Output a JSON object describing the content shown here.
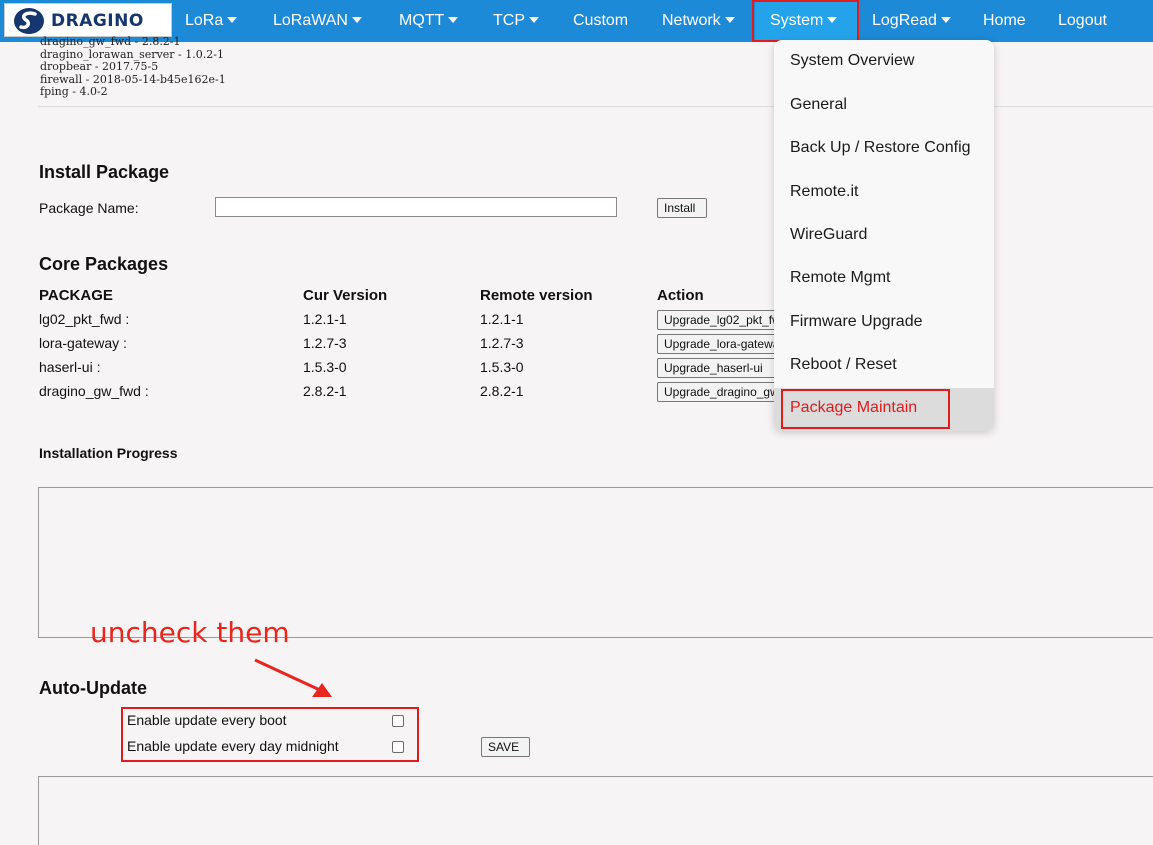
{
  "brand": {
    "logo_text": "DRAGINO",
    "logo_icon": "dragino-s-logo-icon"
  },
  "nav": {
    "items": [
      {
        "label": "LoRa",
        "dropdown": true
      },
      {
        "label": "LoRaWAN",
        "dropdown": true
      },
      {
        "label": "MQTT",
        "dropdown": true
      },
      {
        "label": "TCP",
        "dropdown": true
      },
      {
        "label": "Custom",
        "dropdown": false
      },
      {
        "label": "Network",
        "dropdown": true
      },
      {
        "label": "System",
        "dropdown": true,
        "active": true
      },
      {
        "label": "LogRead",
        "dropdown": true
      },
      {
        "label": "Home",
        "dropdown": false
      },
      {
        "label": "Logout",
        "dropdown": false
      }
    ]
  },
  "installed_packages": [
    "dragino_gw_fwd - 2.8.2-1",
    "dragino_lorawan_server - 1.0.2-1",
    "dropbear - 2017.75-5",
    "firewall - 2018-05-14-b45e162e-1",
    "fping - 4.0-2"
  ],
  "install": {
    "title": "Install Package",
    "label": "Package Name:",
    "value": "",
    "button": "Install"
  },
  "core": {
    "title": "Core Packages",
    "headers": [
      "PACKAGE",
      "Cur Version",
      "Remote version",
      "Action"
    ],
    "rows": [
      {
        "package": "lg02_pkt_fwd :",
        "cur": "1.2.1-1",
        "remote": "1.2.1-1",
        "action": "Upgrade_lg02_pkt_fwd"
      },
      {
        "package": "lora-gateway :",
        "cur": "1.2.7-3",
        "remote": "1.2.7-3",
        "action": "Upgrade_lora-gateway"
      },
      {
        "package": "haserl-ui :",
        "cur": "1.5.3-0",
        "remote": "1.5.3-0",
        "action": "Upgrade_haserl-ui"
      },
      {
        "package": "dragino_gw_fwd :",
        "cur": "2.8.2-1",
        "remote": "2.8.2-1",
        "action": "Upgrade_dragino_gw_fwd"
      }
    ]
  },
  "progress": {
    "title": "Installation Progress"
  },
  "annotation": {
    "text": "uncheck them",
    "color": "#e8261d"
  },
  "auto_update": {
    "title": "Auto-Update",
    "options": [
      {
        "label": "Enable update every boot",
        "checked": false
      },
      {
        "label": "Enable update every day midnight",
        "checked": false
      }
    ],
    "save": "SAVE"
  },
  "system_menu": {
    "items": [
      "System Overview",
      "General",
      "Back Up / Restore Config",
      "Remote.it",
      "WireGuard",
      "Remote Mgmt",
      "Firmware Upgrade",
      "Reboot / Reset",
      "Package Maintain"
    ],
    "highlighted": "Package Maintain"
  },
  "colors": {
    "navbar": "#1c8ad6",
    "active_tab": "#25a3ea",
    "highlight_box": "#e01c1c"
  }
}
